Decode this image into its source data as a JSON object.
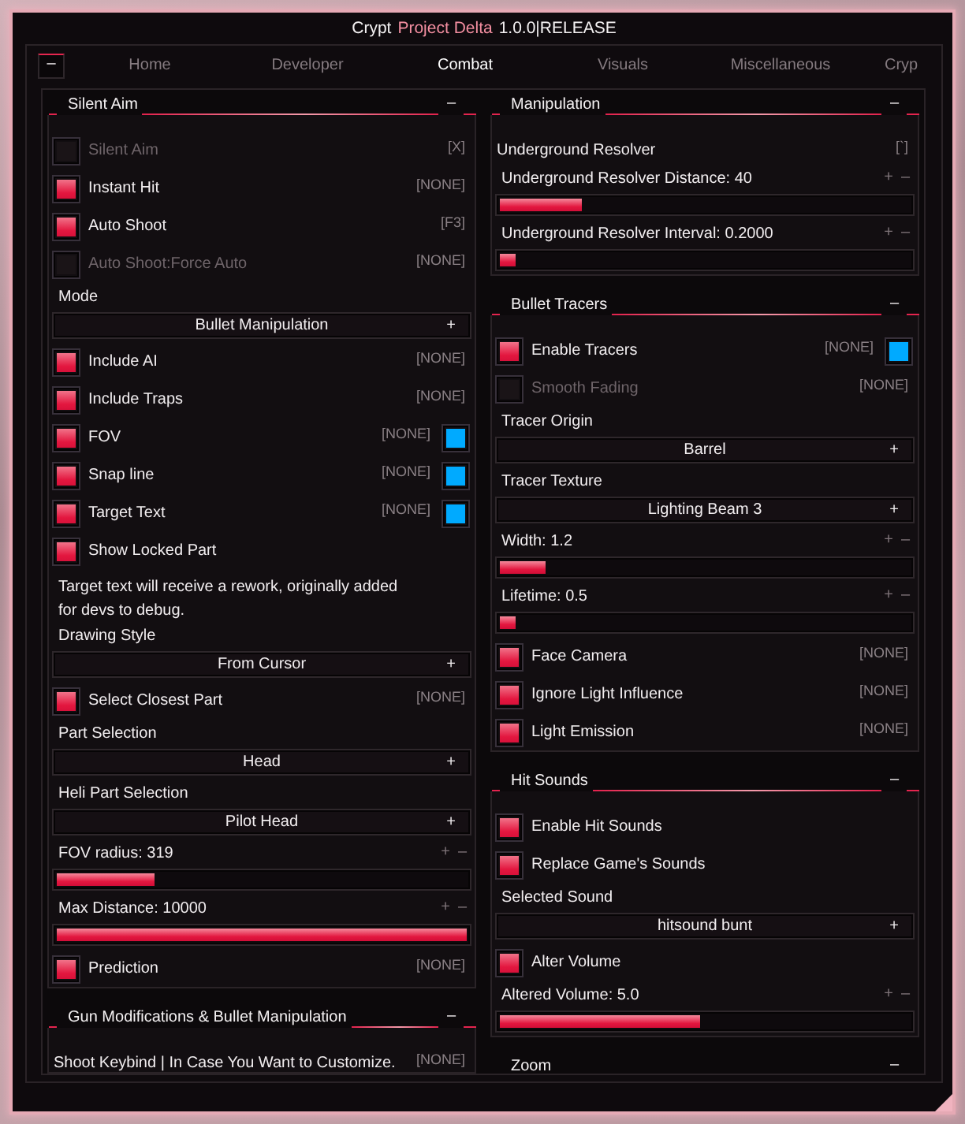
{
  "window": {
    "title": [
      {
        "text": "Crypt",
        "accent": false
      },
      {
        "text": "Project Delta",
        "accent": true
      },
      {
        "text": "1.0.0|RELEASE",
        "accent": false
      }
    ]
  },
  "collapse_button": {
    "label": "–"
  },
  "tabs": [
    {
      "label": "Home",
      "selected": false
    },
    {
      "label": "Developer",
      "selected": false
    },
    {
      "label": "Combat",
      "selected": true
    },
    {
      "label": "Visuals",
      "selected": false
    },
    {
      "label": "Miscellaneous",
      "selected": false
    },
    {
      "label": "Cryp",
      "selected": false
    }
  ],
  "columns": [
    {
      "sections": [
        {
          "title": "Silent Aim",
          "collapse": "–",
          "items": [
            {
              "kind": "toggle",
              "label": "Silent Aim",
              "checked": false,
              "keybind": "[X]"
            },
            {
              "kind": "toggle",
              "label": "Instant Hit",
              "checked": true,
              "keybind": "[NONE]"
            },
            {
              "kind": "toggle",
              "label": "Auto Shoot",
              "checked": true,
              "keybind": "[F3]"
            },
            {
              "kind": "toggle",
              "label": "Auto Shoot:Force Auto",
              "checked": false,
              "keybind": "[NONE]"
            },
            {
              "kind": "label",
              "text": "Mode"
            },
            {
              "kind": "dropdown",
              "value": "Bullet Manipulation",
              "button": "+"
            },
            {
              "kind": "toggle",
              "label": "Include AI",
              "checked": true,
              "keybind": "[NONE]"
            },
            {
              "kind": "toggle",
              "label": "Include Traps",
              "checked": true,
              "keybind": "[NONE]"
            },
            {
              "kind": "toggle",
              "label": "FOV",
              "checked": true,
              "keybind": "[NONE]",
              "color": "#00aaff"
            },
            {
              "kind": "toggle",
              "label": "Snap line",
              "checked": true,
              "keybind": "[NONE]",
              "color": "#00aaff"
            },
            {
              "kind": "toggle",
              "label": "Target Text",
              "checked": true,
              "keybind": "[NONE]",
              "color": "#00aaff"
            },
            {
              "kind": "toggle",
              "label": "Show Locked Part",
              "checked": true
            },
            {
              "kind": "note",
              "text": "Target text will receive a rework, originally added for devs to debug."
            },
            {
              "kind": "label",
              "text": "Drawing Style"
            },
            {
              "kind": "dropdown",
              "value": "From Cursor",
              "button": "+"
            },
            {
              "kind": "toggle",
              "label": "Select Closest Part",
              "checked": true,
              "keybind": "[NONE]"
            },
            {
              "kind": "label",
              "text": "Part Selection"
            },
            {
              "kind": "dropdown",
              "value": "Head",
              "button": "+"
            },
            {
              "kind": "label",
              "text": "Heli Part Selection"
            },
            {
              "kind": "dropdown",
              "value": "Pilot Head",
              "button": "+"
            },
            {
              "kind": "slider",
              "label": "FOV radius: 319",
              "increase": "+",
              "decrease": "–",
              "level": 0.24
            },
            {
              "kind": "slider",
              "label": "Max Distance: 10000",
              "increase": "+",
              "decrease": "–",
              "level": 1
            },
            {
              "kind": "toggle",
              "label": "Prediction",
              "checked": true,
              "keybind": "[NONE]"
            }
          ]
        },
        {
          "title": "Gun Modifications & Bullet Manipulation",
          "collapse": "–",
          "items": [
            {
              "kind": "keybind",
              "label": "Shoot Keybind | In Case You Want to Customize.",
              "keybind": "[NONE]"
            }
          ]
        }
      ]
    },
    {
      "sections": [
        {
          "title": "Manipulation",
          "collapse": "–",
          "items": [
            {
              "kind": "keybind",
              "label": "Underground Resolver",
              "keybind": "[`]"
            },
            {
              "kind": "slider",
              "label": "Underground Resolver Distance: 40",
              "increase": "+",
              "decrease": "–",
              "level": 0.2
            },
            {
              "kind": "slider",
              "label": "Underground Resolver Interval: 0.2000",
              "increase": "+",
              "decrease": "–",
              "level": 0.04
            }
          ]
        },
        {
          "title": "Bullet Tracers",
          "collapse": "–",
          "items": [
            {
              "kind": "toggle",
              "label": "Enable Tracers",
              "checked": true,
              "keybind": "[NONE]",
              "color": "#00aaff"
            },
            {
              "kind": "toggle",
              "label": "Smooth Fading",
              "checked": false,
              "keybind": "[NONE]"
            },
            {
              "kind": "label",
              "text": "Tracer Origin"
            },
            {
              "kind": "dropdown",
              "value": "Barrel",
              "button": "+"
            },
            {
              "kind": "label",
              "text": "Tracer Texture"
            },
            {
              "kind": "dropdown",
              "value": "Lighting Beam 3",
              "button": "+"
            },
            {
              "kind": "slider",
              "label": "Width: 1.2",
              "increase": "+",
              "decrease": "–",
              "level": 0.11
            },
            {
              "kind": "slider",
              "label": "Lifetime: 0.5",
              "increase": "+",
              "decrease": "–",
              "level": 0.04
            },
            {
              "kind": "toggle",
              "label": "Face Camera",
              "checked": true,
              "keybind": "[NONE]"
            },
            {
              "kind": "toggle",
              "label": "Ignore Light Influence",
              "checked": true,
              "keybind": "[NONE]"
            },
            {
              "kind": "toggle",
              "label": "Light Emission",
              "checked": true,
              "keybind": "[NONE]"
            }
          ]
        },
        {
          "title": "Hit Sounds",
          "collapse": "–",
          "items": [
            {
              "kind": "toggle",
              "label": "Enable Hit Sounds",
              "checked": true
            },
            {
              "kind": "toggle",
              "label": "Replace Game's Sounds",
              "checked": true
            },
            {
              "kind": "label",
              "text": "Selected Sound"
            },
            {
              "kind": "dropdown",
              "value": "hitsound bunt",
              "button": "+"
            },
            {
              "kind": "toggle",
              "label": "Alter Volume",
              "checked": true
            },
            {
              "kind": "slider",
              "label": "Altered Volume: 5.0",
              "increase": "+",
              "decrease": "–",
              "level": 0.49
            }
          ]
        },
        {
          "title": "Zoom",
          "collapse": "–"
        }
      ]
    }
  ]
}
